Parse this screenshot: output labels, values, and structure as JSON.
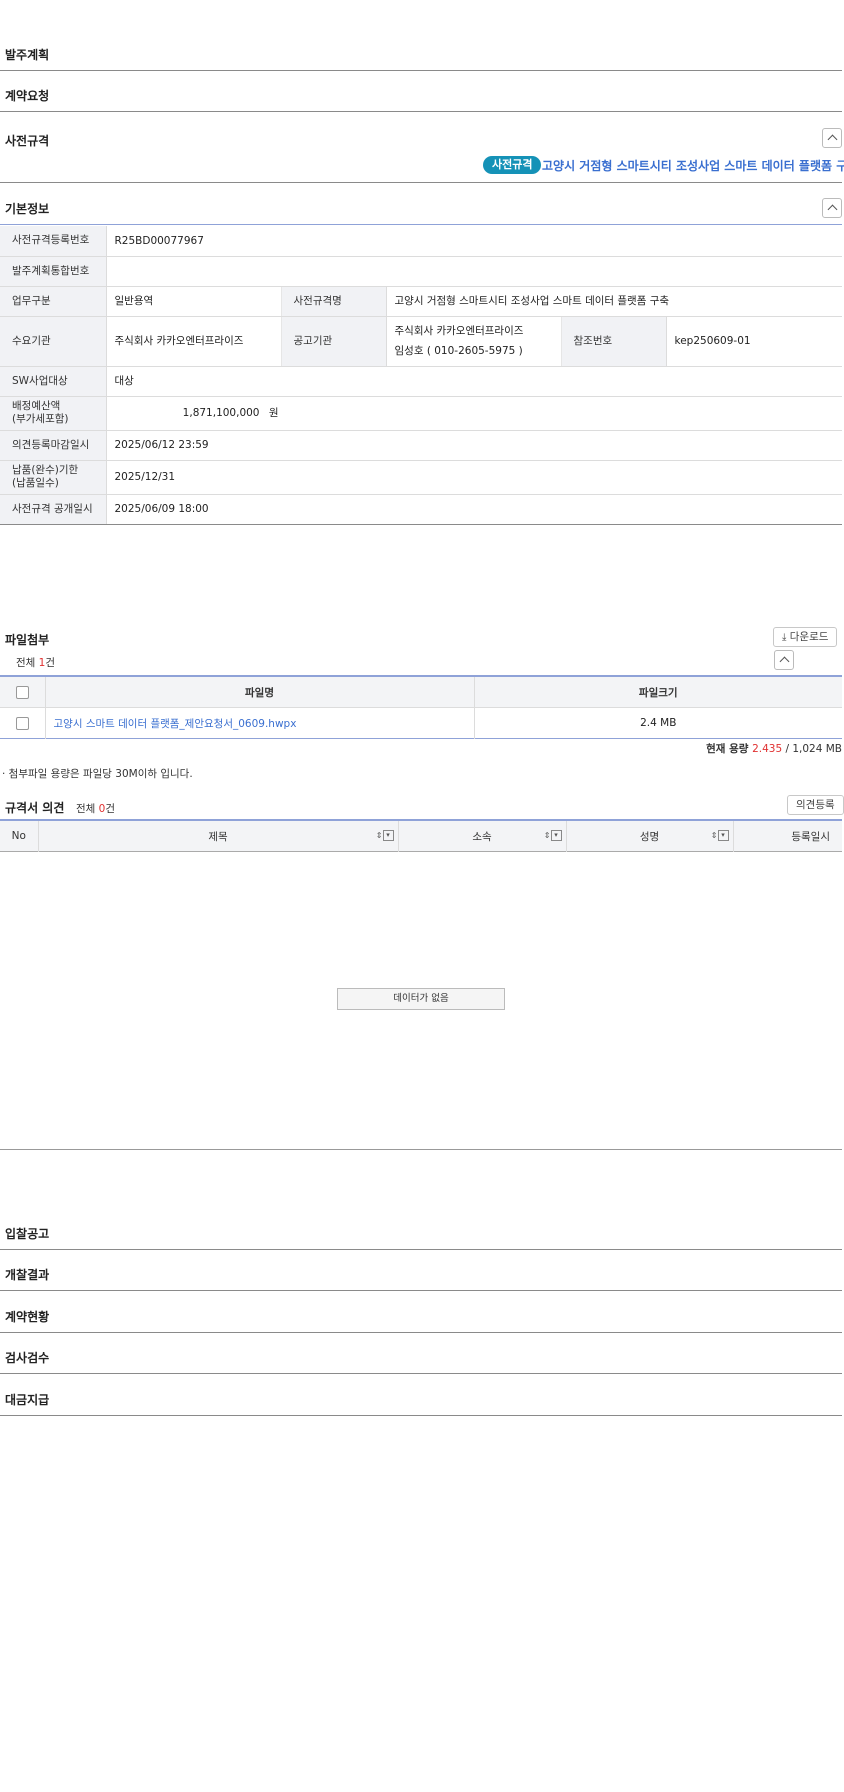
{
  "sections_top": [
    {
      "title": "발주계획"
    },
    {
      "title": "계약요청"
    },
    {
      "title": "사전규격"
    }
  ],
  "pre_spec": {
    "badge": "사전규격",
    "headline": "고양시 거점형 스마트시티 조성사업 스마트 데이터 플랫폼 구축"
  },
  "basic_info": {
    "title": "기본정보",
    "rows": {
      "reg_no": {
        "label": "사전규격등록번호",
        "value": "R25BD00077967"
      },
      "plan_no": {
        "label": "발주계획통합번호",
        "value": ""
      },
      "biz_type": {
        "label": "업무구분",
        "value": "일반용역"
      },
      "spec_name": {
        "label": "사전규격명",
        "value": "고양시 거점형 스마트시티 조성사업 스마트 데이터 플랫폼 구축"
      },
      "demand_org": {
        "label": "수요기관",
        "value": "주식회사 카카오엔터프라이즈"
      },
      "notice_org": {
        "label": "공고기관",
        "value": "주식회사 카카오엔터프라이즈",
        "contact": "임성호 ( 010-2605-5975 )"
      },
      "ref_no": {
        "label": "참조번호",
        "value": "kep250609-01"
      },
      "sw_target": {
        "label": "SW사업대상",
        "value": "대상"
      },
      "budget": {
        "label_1": "배정예산액",
        "label_2": "(부가세포함)",
        "value": "1,871,100,000",
        "unit": "원"
      },
      "opinion_deadline": {
        "label": "의견등록마감일시",
        "value": "2025/06/12 23:59"
      },
      "delivery": {
        "label_1": "납품(완수)기한",
        "label_2": "(납품일수)",
        "value": "2025/12/31"
      },
      "public_date": {
        "label": "사전규격 공개일시",
        "value": "2025/06/09 18:00"
      }
    }
  },
  "attachments": {
    "title": "파일첨부",
    "total_prefix": "전체 ",
    "total_count": "1",
    "total_suffix": "건",
    "download_label": "다운로드",
    "col_name": "파일명",
    "col_size": "파일크기",
    "files": [
      {
        "name": "고양시 스마트 데이터 플랫폼_제안요청서_0609.hwpx",
        "size": "2.4 MB"
      }
    ],
    "capacity_label": "현재 용량 ",
    "capacity_used": "2.435",
    "capacity_total": " / 1,024 MB",
    "note": "· 첨부파일 용량은 파일당 30M이하 입니다."
  },
  "opinions": {
    "title": "규격서 의견",
    "total_prefix": "전체 ",
    "total_count": "0",
    "total_suffix": "건",
    "register_label": "의견등록",
    "columns": {
      "no": "No",
      "subject": "제목",
      "dept": "소속",
      "name": "성명",
      "date": "등록일시"
    },
    "empty": "데이터가 없음"
  },
  "sections_bottom": [
    {
      "title": "입찰공고"
    },
    {
      "title": "개찰결과"
    },
    {
      "title": "계약현황"
    },
    {
      "title": "검사검수"
    },
    {
      "title": "대금지급"
    }
  ]
}
